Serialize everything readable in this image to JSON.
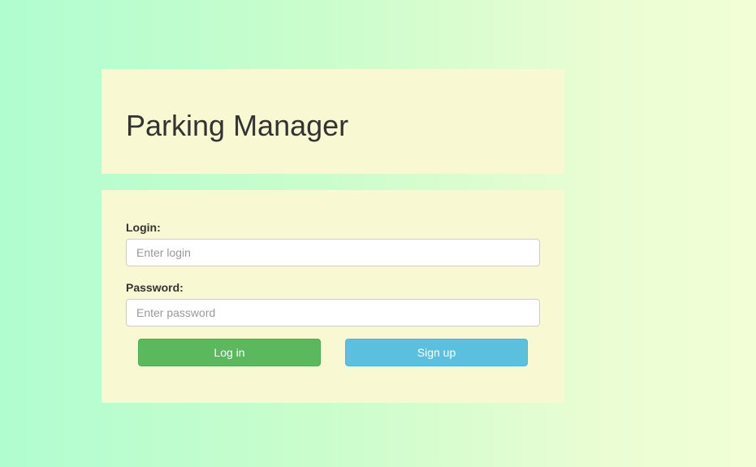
{
  "header": {
    "title": "Parking Manager"
  },
  "login_form": {
    "login_label": "Login:",
    "login_placeholder": "Enter login",
    "password_label": "Password:",
    "password_placeholder": "Enter password",
    "login_button": "Log in",
    "signup_button": "Sign up"
  },
  "colors": {
    "panel_background": "#f8f9d2",
    "login_button": "#5cb85c",
    "signup_button": "#5bc0de",
    "page_gradient_start": "#b0fdd0",
    "page_gradient_end": "#f2fed6"
  }
}
